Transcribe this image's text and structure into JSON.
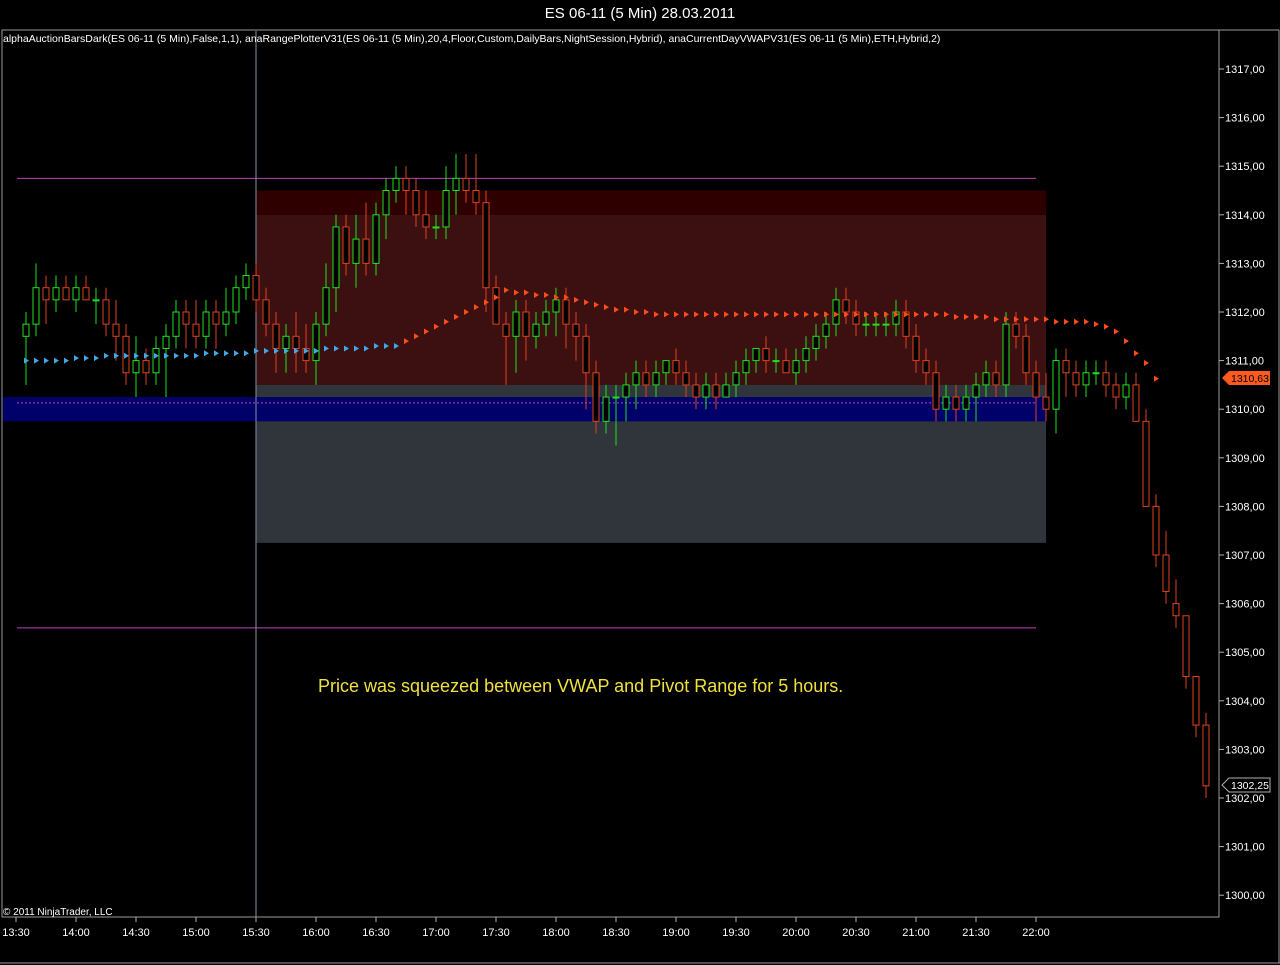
{
  "window": {
    "title": "ES 06-11 (5 Min)  28.03.2011"
  },
  "indicators_label": "alphaAuctionBarsDark(ES 06-11  (5 Min),False,1,1),  anaRangePlotterV31(ES 06-11  (5 Min),20,4,Floor,Custom,DailyBars,NightSession,Hybrid),  anaCurrentDayVWAPV31(ES 06-11  (5 Min),ETH,Hybrid,2)",
  "copyright": "© 2011 NinjaTrader, LLC",
  "annotation": "Price was squeezed between VWAP and Pivot Range for  5 hours.",
  "colors": {
    "background": "#000000",
    "up_candle": "#20e020",
    "down_candle": "#e04020",
    "vwap_before": "#40a8e8",
    "vwap_after": "#ff4a1a",
    "pivot_band": "#00006a",
    "range_upper": "#3c1010",
    "range_top": "#2e0000",
    "range_lower": "#30353c",
    "magenta_line": "#c040c0",
    "annotation": "#f0e040"
  },
  "badges": {
    "last_price": "1310,63",
    "other_price": "1302,25"
  },
  "chart_data": {
    "type": "candlestick",
    "title": "ES 06-11 (5 Min)  28.03.2011",
    "x_ticks": [
      "13:30",
      "14:00",
      "14:30",
      "15:00",
      "15:30",
      "16:00",
      "16:30",
      "17:00",
      "17:30",
      "18:00",
      "18:30",
      "19:00",
      "19:30",
      "20:00",
      "20:30",
      "21:00",
      "21:30",
      "22:00"
    ],
    "y_ticks": [
      "1300,00",
      "1301,00",
      "1302,00",
      "1303,00",
      "1304,00",
      "1305,00",
      "1306,00",
      "1307,00",
      "1308,00",
      "1309,00",
      "1310,00",
      "1311,00",
      "1312,00",
      "1313,00",
      "1314,00",
      "1315,00",
      "1316,00",
      "1317,00"
    ],
    "ylim": [
      1299.6,
      1317.4
    ],
    "bar_minutes": 5,
    "first_bar": "13:35",
    "session_start": "15:30",
    "range_end": "22:05",
    "levels": {
      "upper_magenta": 1314.75,
      "lower_magenta": 1305.5,
      "range_top_dark_band": [
        1314.0,
        1314.5
      ],
      "range_upper_zone": [
        1310.5,
        1314.0
      ],
      "range_lower_zone": [
        1307.25,
        1310.5
      ],
      "pivot_band": [
        1309.75,
        1310.25
      ],
      "pivot_line": 1310.13
    },
    "vwap": [
      1311.0,
      1311.0,
      1311.0,
      1311.0,
      1311.0,
      1311.05,
      1311.05,
      1311.05,
      1311.1,
      1311.1,
      1311.1,
      1311.1,
      1311.1,
      1311.1,
      1311.1,
      1311.1,
      1311.1,
      1311.1,
      1311.15,
      1311.15,
      1311.15,
      1311.15,
      1311.15,
      1311.2,
      1311.2,
      1311.2,
      1311.2,
      1311.2,
      1311.2,
      1311.2,
      1311.25,
      1311.25,
      1311.25,
      1311.25,
      1311.25,
      1311.3,
      1311.3,
      1311.3,
      1311.4,
      1311.5,
      1311.6,
      1311.7,
      1311.8,
      1311.9,
      1312.0,
      1312.1,
      1312.2,
      1312.3,
      1312.45,
      1312.4,
      1312.4,
      1312.35,
      1312.35,
      1312.3,
      1312.3,
      1312.25,
      1312.2,
      1312.15,
      1312.1,
      1312.05,
      1312.05,
      1312.0,
      1312.0,
      1311.95,
      1311.95,
      1311.95,
      1311.95,
      1311.95,
      1311.95,
      1311.95,
      1311.95,
      1311.95,
      1311.95,
      1311.95,
      1311.95,
      1311.95,
      1311.95,
      1311.95,
      1311.95,
      1311.95,
      1311.95,
      1311.95,
      1311.95,
      1311.95,
      1311.95,
      1311.95,
      1311.95,
      1311.95,
      1311.95,
      1311.95,
      1311.95,
      1311.95,
      1311.95,
      1311.9,
      1311.9,
      1311.9,
      1311.9,
      1311.85,
      1311.85,
      1311.85,
      1311.85,
      1311.85,
      1311.85,
      1311.8,
      1311.8,
      1311.8,
      1311.8,
      1311.75,
      1311.7,
      1311.6,
      1311.4,
      1311.15,
      1310.95,
      1310.63
    ],
    "ohlc": [
      [
        1311.5,
        1312.0,
        1310.5,
        1311.75
      ],
      [
        1311.75,
        1313.0,
        1311.5,
        1312.5
      ],
      [
        1312.5,
        1312.75,
        1311.75,
        1312.25
      ],
      [
        1312.25,
        1312.75,
        1312.0,
        1312.5
      ],
      [
        1312.5,
        1312.75,
        1312.25,
        1312.25
      ],
      [
        1312.25,
        1312.75,
        1312.0,
        1312.5
      ],
      [
        1312.5,
        1312.75,
        1312.25,
        1312.25
      ],
      [
        1312.25,
        1312.5,
        1311.75,
        1312.25
      ],
      [
        1312.25,
        1312.5,
        1311.5,
        1311.75
      ],
      [
        1311.75,
        1312.25,
        1311.0,
        1311.5
      ],
      [
        1311.5,
        1311.75,
        1310.5,
        1310.75
      ],
      [
        1310.75,
        1311.5,
        1310.25,
        1311.0
      ],
      [
        1311.0,
        1311.25,
        1310.5,
        1310.75
      ],
      [
        1310.75,
        1311.5,
        1310.5,
        1311.25
      ],
      [
        1311.25,
        1311.75,
        1310.25,
        1311.5
      ],
      [
        1311.5,
        1312.25,
        1311.25,
        1312.0
      ],
      [
        1312.0,
        1312.25,
        1311.25,
        1311.75
      ],
      [
        1311.75,
        1312.25,
        1311.25,
        1311.5
      ],
      [
        1311.5,
        1312.25,
        1311.25,
        1312.0
      ],
      [
        1312.0,
        1312.25,
        1311.25,
        1311.75
      ],
      [
        1311.75,
        1312.5,
        1311.5,
        1312.0
      ],
      [
        1312.0,
        1312.75,
        1311.75,
        1312.5
      ],
      [
        1312.5,
        1313.0,
        1312.25,
        1312.75
      ],
      [
        1312.75,
        1313.0,
        1312.0,
        1312.25
      ],
      [
        1312.25,
        1312.5,
        1311.5,
        1311.75
      ],
      [
        1311.75,
        1312.0,
        1310.75,
        1311.25
      ],
      [
        1311.25,
        1311.75,
        1310.75,
        1311.5
      ],
      [
        1311.5,
        1312.0,
        1310.75,
        1311.25
      ],
      [
        1311.25,
        1311.75,
        1310.75,
        1311.0
      ],
      [
        1311.0,
        1312.0,
        1310.5,
        1311.75
      ],
      [
        1311.75,
        1313.0,
        1311.5,
        1312.5
      ],
      [
        1312.5,
        1314.0,
        1312.0,
        1313.75
      ],
      [
        1313.75,
        1314.0,
        1312.75,
        1313.0
      ],
      [
        1313.0,
        1314.0,
        1312.5,
        1313.5
      ],
      [
        1313.5,
        1314.25,
        1312.75,
        1313.0
      ],
      [
        1313.0,
        1314.25,
        1312.75,
        1314.0
      ],
      [
        1314.0,
        1314.75,
        1313.5,
        1314.5
      ],
      [
        1314.5,
        1315.0,
        1314.25,
        1314.75
      ],
      [
        1314.75,
        1315.0,
        1314.0,
        1314.5
      ],
      [
        1314.5,
        1314.75,
        1313.75,
        1314.0
      ],
      [
        1314.0,
        1314.5,
        1313.5,
        1313.75
      ],
      [
        1313.75,
        1314.0,
        1313.5,
        1313.75
      ],
      [
        1313.75,
        1315.0,
        1313.5,
        1314.5
      ],
      [
        1314.5,
        1315.25,
        1314.0,
        1314.75
      ],
      [
        1314.75,
        1315.25,
        1314.25,
        1314.5
      ],
      [
        1314.5,
        1315.25,
        1314.0,
        1314.25
      ],
      [
        1314.25,
        1314.5,
        1312.0,
        1312.5
      ],
      [
        1312.5,
        1312.75,
        1311.75,
        1311.75
      ],
      [
        1311.75,
        1312.0,
        1310.5,
        1311.5
      ],
      [
        1311.5,
        1312.25,
        1310.75,
        1312.0
      ],
      [
        1312.0,
        1312.25,
        1311.0,
        1311.5
      ],
      [
        1311.5,
        1312.0,
        1311.25,
        1311.75
      ],
      [
        1311.75,
        1312.25,
        1311.5,
        1312.0
      ],
      [
        1312.0,
        1312.5,
        1311.5,
        1312.25
      ],
      [
        1312.25,
        1312.5,
        1311.25,
        1311.75
      ],
      [
        1311.75,
        1312.0,
        1311.0,
        1311.5
      ],
      [
        1311.5,
        1311.75,
        1310.0,
        1310.75
      ],
      [
        1310.75,
        1311.0,
        1309.5,
        1309.75
      ],
      [
        1309.75,
        1310.5,
        1309.5,
        1310.25
      ],
      [
        1310.25,
        1310.5,
        1309.25,
        1310.25
      ],
      [
        1310.25,
        1310.75,
        1309.75,
        1310.5
      ],
      [
        1310.5,
        1311.0,
        1310.0,
        1310.75
      ],
      [
        1310.75,
        1311.0,
        1310.25,
        1310.5
      ],
      [
        1310.5,
        1311.0,
        1310.25,
        1310.75
      ],
      [
        1310.75,
        1311.0,
        1310.5,
        1311.0
      ],
      [
        1311.0,
        1311.25,
        1310.5,
        1310.75
      ],
      [
        1310.75,
        1311.0,
        1310.25,
        1310.5
      ],
      [
        1310.5,
        1310.75,
        1310.0,
        1310.25
      ],
      [
        1310.25,
        1310.75,
        1310.0,
        1310.5
      ],
      [
        1310.5,
        1310.75,
        1310.0,
        1310.25
      ],
      [
        1310.25,
        1310.75,
        1310.25,
        1310.5
      ],
      [
        1310.5,
        1311.0,
        1310.25,
        1310.75
      ],
      [
        1310.75,
        1311.25,
        1310.5,
        1311.0
      ],
      [
        1311.0,
        1311.25,
        1310.75,
        1311.25
      ],
      [
        1311.25,
        1311.5,
        1310.75,
        1311.0
      ],
      [
        1311.0,
        1311.25,
        1310.75,
        1311.0
      ],
      [
        1311.0,
        1311.25,
        1310.75,
        1310.75
      ],
      [
        1310.75,
        1311.25,
        1310.5,
        1311.0
      ],
      [
        1311.0,
        1311.5,
        1310.75,
        1311.25
      ],
      [
        1311.25,
        1311.75,
        1311.0,
        1311.5
      ],
      [
        1311.5,
        1312.0,
        1311.25,
        1311.75
      ],
      [
        1311.75,
        1312.5,
        1311.5,
        1312.25
      ],
      [
        1312.25,
        1312.5,
        1311.75,
        1312.0
      ],
      [
        1312.0,
        1312.25,
        1311.5,
        1311.75
      ],
      [
        1311.75,
        1312.0,
        1311.5,
        1311.75
      ],
      [
        1311.75,
        1312.0,
        1311.5,
        1311.75
      ],
      [
        1311.75,
        1312.0,
        1311.5,
        1311.75
      ],
      [
        1311.75,
        1312.25,
        1311.5,
        1312.0
      ],
      [
        1312.0,
        1312.25,
        1311.25,
        1311.5
      ],
      [
        1311.5,
        1311.75,
        1310.75,
        1311.0
      ],
      [
        1311.0,
        1311.25,
        1310.5,
        1310.75
      ],
      [
        1310.75,
        1311.0,
        1309.75,
        1310.0
      ],
      [
        1310.0,
        1310.5,
        1309.75,
        1310.25
      ],
      [
        1310.25,
        1310.5,
        1309.75,
        1310.0
      ],
      [
        1310.0,
        1310.5,
        1309.75,
        1310.25
      ],
      [
        1310.25,
        1310.75,
        1309.75,
        1310.5
      ],
      [
        1310.5,
        1311.0,
        1310.25,
        1310.75
      ],
      [
        1310.75,
        1311.0,
        1310.25,
        1310.5
      ],
      [
        1310.5,
        1312.0,
        1310.25,
        1311.75
      ],
      [
        1311.75,
        1312.0,
        1311.25,
        1311.5
      ],
      [
        1311.5,
        1311.75,
        1310.5,
        1310.75
      ],
      [
        1310.75,
        1311.0,
        1309.75,
        1310.25
      ],
      [
        1310.25,
        1310.75,
        1309.75,
        1310.0
      ],
      [
        1310.0,
        1311.25,
        1309.5,
        1311.0
      ],
      [
        1311.0,
        1311.25,
        1310.25,
        1310.75
      ],
      [
        1310.75,
        1311.0,
        1310.25,
        1310.5
      ],
      [
        1310.5,
        1311.0,
        1310.25,
        1310.75
      ],
      [
        1310.75,
        1311.0,
        1310.5,
        1310.75
      ],
      [
        1310.75,
        1311.0,
        1310.25,
        1310.5
      ],
      [
        1310.5,
        1310.75,
        1310.0,
        1310.25
      ],
      [
        1310.25,
        1310.75,
        1310.0,
        1310.5
      ],
      [
        1310.5,
        1310.75,
        1309.75,
        1309.75
      ],
      [
        1309.75,
        1310.0,
        1308.25,
        1308.0
      ],
      [
        1308.0,
        1308.25,
        1306.75,
        1307.0
      ],
      [
        1307.0,
        1307.5,
        1306.0,
        1306.25
      ],
      [
        1306.0,
        1306.5,
        1305.5,
        1305.75
      ],
      [
        1305.75,
        1305.75,
        1304.25,
        1304.5
      ],
      [
        1304.5,
        1304.5,
        1303.25,
        1303.5
      ],
      [
        1303.5,
        1303.75,
        1302.0,
        1302.25
      ]
    ]
  }
}
